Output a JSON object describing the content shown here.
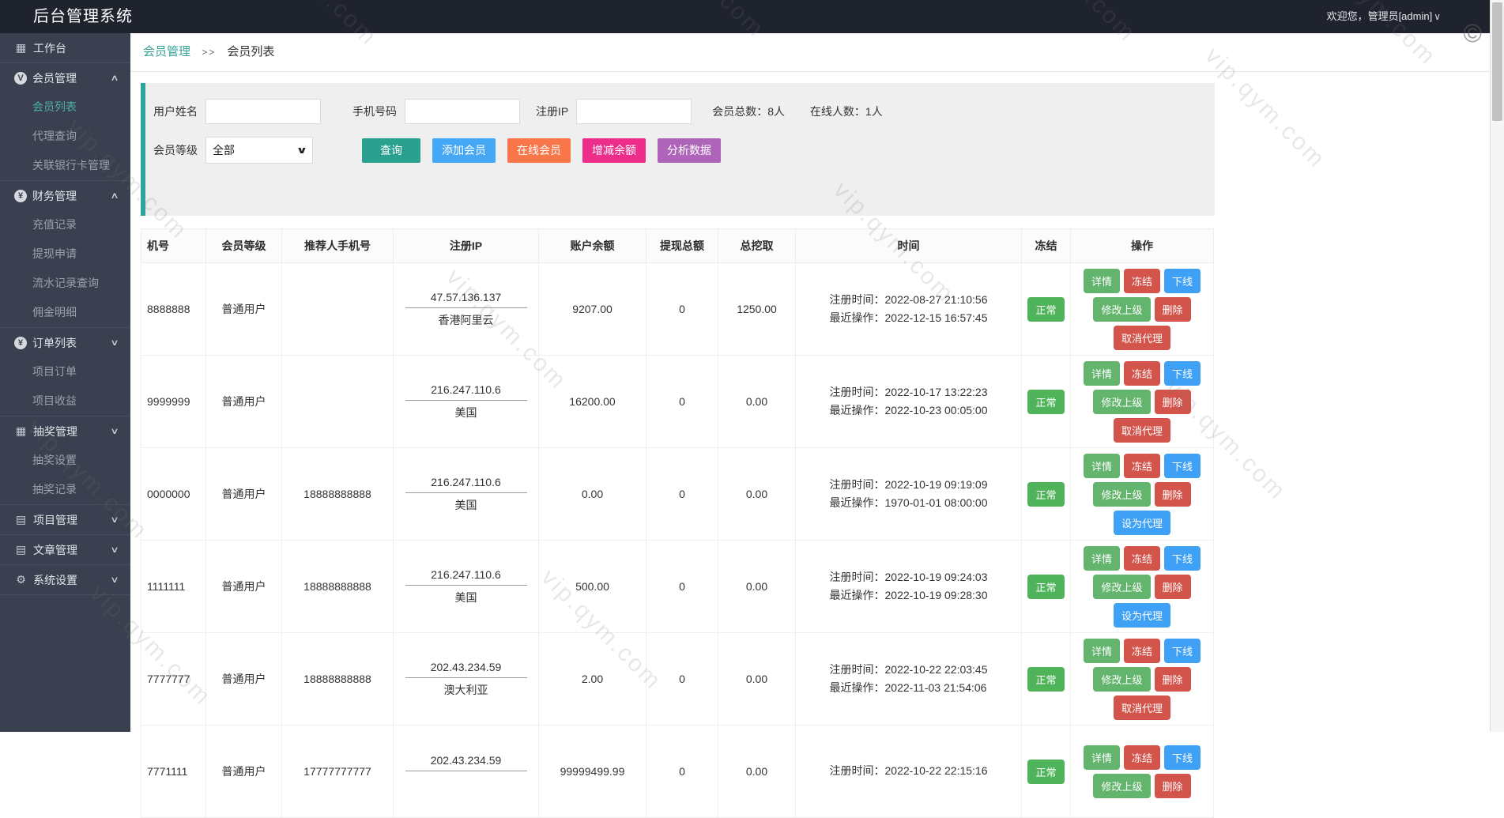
{
  "header": {
    "title": "后台管理系统",
    "welcome": "欢迎您，管理员[admin]",
    "dropdown_glyph": "∨"
  },
  "watermark": {
    "text": "vip.qym.com",
    "copyright_glyph": "©"
  },
  "icons": {
    "dashboard-icon": "▦",
    "member-icon": "V",
    "finance-icon": "¥",
    "order-icon": "¥",
    "lottery-icon": "▦",
    "project-icon": "▤",
    "article-icon": "▤",
    "settings-icon": "⚙",
    "chevron-up": "∧",
    "chevron-down": "∨",
    "select-arrow": "∨"
  },
  "sidebar": {
    "groups": [
      {
        "id": "workbench",
        "label": "工作台",
        "icon": "dashboard-icon",
        "icon_style": "plain",
        "chevron": null,
        "children": []
      },
      {
        "id": "member-management",
        "label": "会员管理",
        "icon": "member-icon",
        "icon_style": "circle",
        "chevron": "up",
        "children": [
          {
            "label": "会员列表",
            "active": true
          },
          {
            "label": "代理查询",
            "active": false
          },
          {
            "label": "关联银行卡管理",
            "active": false
          }
        ]
      },
      {
        "id": "finance-management",
        "label": "财务管理",
        "icon": "finance-icon",
        "icon_style": "circle",
        "chevron": "up",
        "children": [
          {
            "label": "充值记录",
            "active": false
          },
          {
            "label": "提现申请",
            "active": false
          },
          {
            "label": "流水记录查询",
            "active": false
          },
          {
            "label": "佣金明细",
            "active": false
          }
        ]
      },
      {
        "id": "order-list",
        "label": "订单列表",
        "icon": "order-icon",
        "icon_style": "circle",
        "chevron": "down",
        "children": [
          {
            "label": "项目订单",
            "active": false
          },
          {
            "label": "项目收益",
            "active": false
          }
        ]
      },
      {
        "id": "lottery-management",
        "label": "抽奖管理",
        "icon": "lottery-icon",
        "icon_style": "plain",
        "chevron": "down",
        "children": [
          {
            "label": "抽奖设置",
            "active": false
          },
          {
            "label": "抽奖记录",
            "active": false
          }
        ]
      },
      {
        "id": "project-management",
        "label": "项目管理",
        "icon": "project-icon",
        "icon_style": "plain",
        "chevron": "down",
        "children": []
      },
      {
        "id": "article-management",
        "label": "文章管理",
        "icon": "article-icon",
        "icon_style": "plain",
        "chevron": "down",
        "children": []
      },
      {
        "id": "system-settings",
        "label": "系统设置",
        "icon": "settings-icon",
        "icon_style": "plain",
        "chevron": "down",
        "children": []
      }
    ]
  },
  "breadcrumb": {
    "parent": "会员管理",
    "separator": ">>",
    "current": "会员列表"
  },
  "filters": {
    "username_label": "用户姓名",
    "phone_label": "手机号码",
    "ip_label": "注册IP",
    "level_label": "会员等级",
    "level_value": "全部",
    "stats_total": "会员总数：8人",
    "stats_online": "在线人数：1人",
    "buttons": [
      {
        "id": "query",
        "label": "查询",
        "color": "#2aa08f"
      },
      {
        "id": "add-member",
        "label": "添加会员",
        "color": "#45a8f6"
      },
      {
        "id": "online-members",
        "label": "在线会员",
        "color": "#f8764a"
      },
      {
        "id": "adjust-balance",
        "label": "增减余额",
        "color": "#ee2d8b"
      },
      {
        "id": "analyze-data",
        "label": "分析数据",
        "color": "#ae64b8"
      }
    ]
  },
  "table": {
    "columns": [
      "机号",
      "会员等级",
      "推荐人手机号",
      "注册IP",
      "账户余额",
      "提现总额",
      "总挖取",
      "时间",
      "冻结",
      "操作"
    ],
    "action_labels": {
      "detail": "详情",
      "freeze": "冻结",
      "offline": "下线",
      "modify_parent": "修改上级",
      "delete": "删除"
    },
    "rows": [
      {
        "phone": "8888888",
        "level": "普通用户",
        "referrer": "",
        "ip": "47.57.136.137",
        "location": "香港阿里云",
        "balance": "9207.00",
        "withdraw_total": "0",
        "mined_total": "1250.00",
        "register_time": "注册时间：2022-08-27 21:10:56",
        "last_operation": "最近操作：2022-12-15 16:57:45",
        "status": "正常",
        "agent_button": {
          "label": "取消代理",
          "style": "red"
        }
      },
      {
        "phone": "9999999",
        "level": "普通用户",
        "referrer": "",
        "ip": "216.247.110.6",
        "location": "美国",
        "balance": "16200.00",
        "withdraw_total": "0",
        "mined_total": "0.00",
        "register_time": "注册时间：2022-10-17 13:22:23",
        "last_operation": "最近操作：2022-10-23 00:05:00",
        "status": "正常",
        "agent_button": {
          "label": "取消代理",
          "style": "red"
        }
      },
      {
        "phone": "0000000",
        "level": "普通用户",
        "referrer": "18888888888",
        "ip": "216.247.110.6",
        "location": "美国",
        "balance": "0.00",
        "withdraw_total": "0",
        "mined_total": "0.00",
        "register_time": "注册时间：2022-10-19 09:19:09",
        "last_operation": "最近操作：1970-01-01 08:00:00",
        "status": "正常",
        "agent_button": {
          "label": "设为代理",
          "style": "blue"
        }
      },
      {
        "phone": "1111111",
        "level": "普通用户",
        "referrer": "18888888888",
        "ip": "216.247.110.6",
        "location": "美国",
        "balance": "500.00",
        "withdraw_total": "0",
        "mined_total": "0.00",
        "register_time": "注册时间：2022-10-19 09:24:03",
        "last_operation": "最近操作：2022-10-19 09:28:30",
        "status": "正常",
        "agent_button": {
          "label": "设为代理",
          "style": "blue"
        }
      },
      {
        "phone": "7777777",
        "level": "普通用户",
        "referrer": "18888888888",
        "ip": "202.43.234.59",
        "location": "澳大利亚",
        "balance": "2.00",
        "withdraw_total": "0",
        "mined_total": "0.00",
        "register_time": "注册时间：2022-10-22 22:03:45",
        "last_operation": "最近操作：2022-11-03 21:54:06",
        "status": "正常",
        "agent_button": {
          "label": "取消代理",
          "style": "red"
        }
      },
      {
        "phone": "7771111",
        "level": "普通用户",
        "referrer": "17777777777",
        "ip": "202.43.234.59",
        "location": "",
        "balance": "99999499.99",
        "withdraw_total": "0",
        "mined_total": "0.00",
        "register_time": "注册时间：2022-10-22 22:15:16",
        "last_operation": "",
        "status": "正常",
        "agent_button": null
      }
    ]
  }
}
